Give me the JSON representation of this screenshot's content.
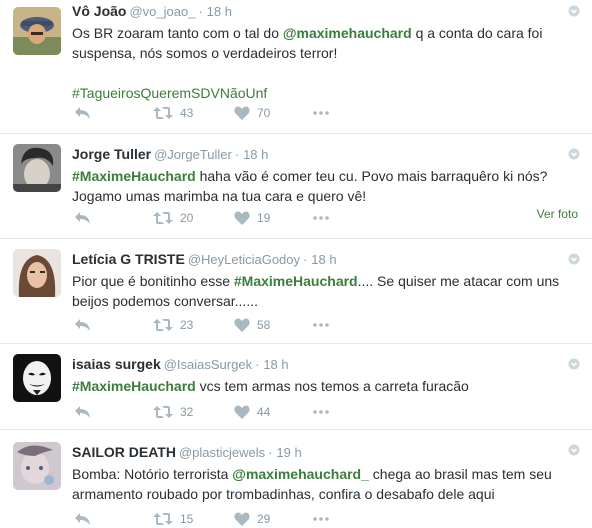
{
  "tweets": [
    {
      "name": "Vô João",
      "handle": "@vo_joao_",
      "time": "18 h",
      "text": {
        "a": "Os BR zoaram tanto com o tal do ",
        "mention": "@maximehauchard",
        "b": " q a conta do cara foi suspensa, nós somos o verdadeiros terror!"
      },
      "hashtag_line": "#TagueirosQueremSDVNãoUnf",
      "retweets": "43",
      "likes": "70"
    },
    {
      "name": "Jorge Tuller",
      "handle": "@JorgeTuller",
      "time": "18 h",
      "text": {
        "hashtag": "#MaximeHauchard",
        "b": " haha vão é comer teu cu. Povo mais barraquêro ki nós? Jogamo umas marimba na tua cara e quero vê!"
      },
      "retweets": "20",
      "likes": "19",
      "media_link": "Ver foto"
    },
    {
      "name": "Letícia G TRISTE",
      "handle": "@HeyLeticiaGodoy",
      "time": "18 h",
      "text": {
        "a": "Pior que é bonitinho esse ",
        "hashtag": "#MaximeHauchard",
        "b": ".... Se quiser me atacar com uns beijos podemos conversar......"
      },
      "retweets": "23",
      "likes": "58"
    },
    {
      "name": "isaias surgek",
      "handle": "@IsaiasSurgek",
      "time": "18 h",
      "text": {
        "hashtag": "#MaximeHauchard",
        "b": " vcs tem armas nos temos a carreta furacão"
      },
      "retweets": "32",
      "likes": "44"
    },
    {
      "name": "SAILOR DEATH",
      "handle": "@plasticjewels",
      "time": "19 h",
      "text": {
        "a": "Bomba: Notório terrorista ",
        "mention": "@maximehauchard_",
        "b": " chega ao brasil mas tem seu armamento roubado por trombadinhas, confira o desabafo dele aqui"
      },
      "retweets": "15",
      "likes": "29"
    }
  ],
  "icons": {
    "reply": "reply-icon",
    "retweet": "retweet-icon",
    "like": "heart-icon",
    "more": "more-dots-icon",
    "menu": "chevron-down-icon"
  },
  "colors": {
    "hashtag": "#3b7d3a",
    "secondary": "#8899a6",
    "icon": "#aab8c2",
    "divider": "#e1e8ed"
  }
}
